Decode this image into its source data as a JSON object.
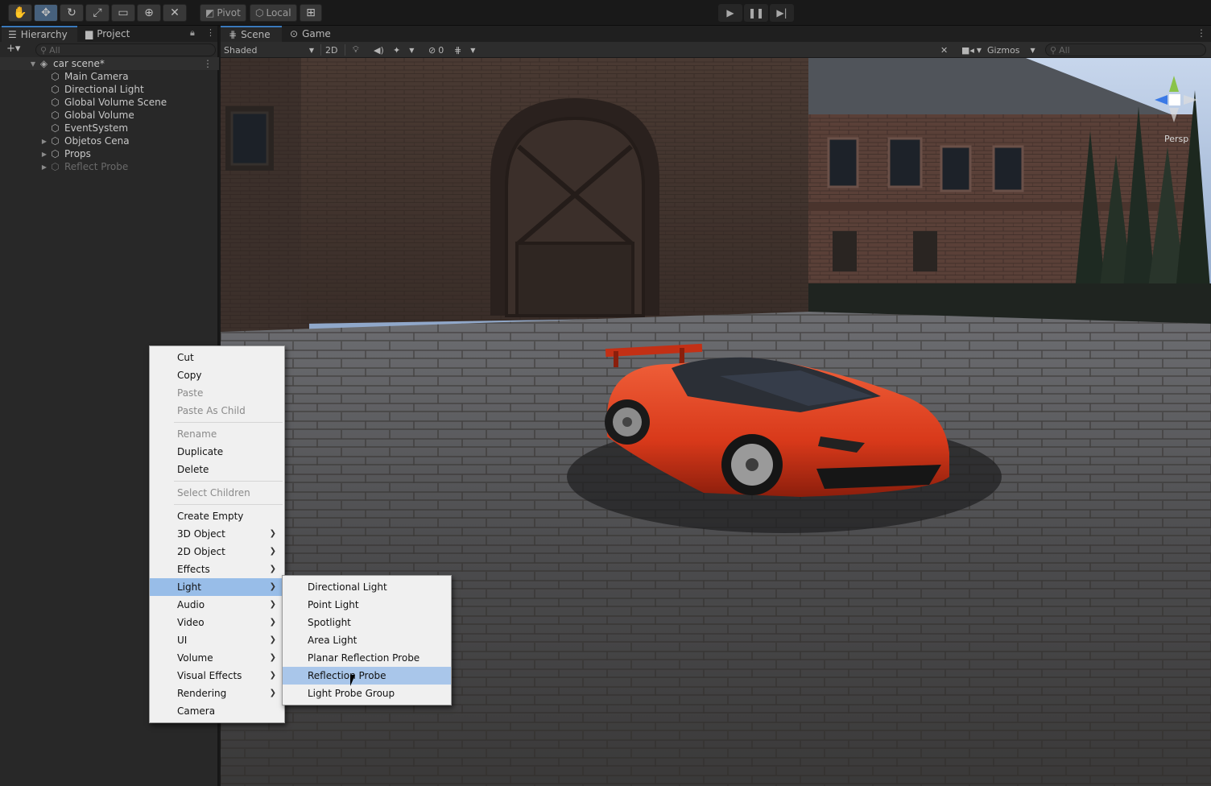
{
  "toolbar": {
    "pivot_label": "Pivot",
    "local_label": "Local",
    "tools": [
      "hand-tool",
      "move-tool",
      "rotate-tool",
      "scale-tool",
      "rect-tool",
      "transform-tool",
      "custom-tool"
    ]
  },
  "hierarchy": {
    "tab_label": "Hierarchy",
    "project_tab_label": "Project",
    "search_placeholder": "All",
    "scene_name": "car scene*",
    "items": [
      {
        "label": "Main Camera",
        "expandable": false,
        "disabled": false
      },
      {
        "label": "Directional Light",
        "expandable": false,
        "disabled": false
      },
      {
        "label": "Global Volume Scene",
        "expandable": false,
        "disabled": false
      },
      {
        "label": "Global Volume",
        "expandable": false,
        "disabled": false
      },
      {
        "label": "EventSystem",
        "expandable": false,
        "disabled": false
      },
      {
        "label": "Objetos Cena",
        "expandable": true,
        "disabled": false
      },
      {
        "label": "Props",
        "expandable": true,
        "disabled": false
      },
      {
        "label": "Reflect Probe",
        "expandable": true,
        "disabled": true
      }
    ]
  },
  "scene_view": {
    "scene_tab": "Scene",
    "game_tab": "Game",
    "shading_mode": "Shaded",
    "mode_2d": "2D",
    "hidden_count": "0",
    "gizmos_label": "Gizmos",
    "search_placeholder": "All",
    "persp_label": "Persp"
  },
  "context_menu": {
    "items": [
      {
        "label": "Cut",
        "disabled": false,
        "submenu": false
      },
      {
        "label": "Copy",
        "disabled": false,
        "submenu": false
      },
      {
        "label": "Paste",
        "disabled": true,
        "submenu": false
      },
      {
        "label": "Paste As Child",
        "disabled": true,
        "submenu": false
      },
      {
        "separator": true
      },
      {
        "label": "Rename",
        "disabled": true,
        "submenu": false
      },
      {
        "label": "Duplicate",
        "disabled": false,
        "submenu": false
      },
      {
        "label": "Delete",
        "disabled": false,
        "submenu": false
      },
      {
        "separator": true
      },
      {
        "label": "Select Children",
        "disabled": true,
        "submenu": false
      },
      {
        "separator": true
      },
      {
        "label": "Create Empty",
        "disabled": false,
        "submenu": false
      },
      {
        "label": "3D Object",
        "disabled": false,
        "submenu": true
      },
      {
        "label": "2D Object",
        "disabled": false,
        "submenu": true
      },
      {
        "label": "Effects",
        "disabled": false,
        "submenu": true
      },
      {
        "label": "Light",
        "disabled": false,
        "submenu": true,
        "highlighted": true
      },
      {
        "label": "Audio",
        "disabled": false,
        "submenu": true
      },
      {
        "label": "Video",
        "disabled": false,
        "submenu": true
      },
      {
        "label": "UI",
        "disabled": false,
        "submenu": true
      },
      {
        "label": "Volume",
        "disabled": false,
        "submenu": true
      },
      {
        "label": "Visual Effects",
        "disabled": false,
        "submenu": true
      },
      {
        "label": "Rendering",
        "disabled": false,
        "submenu": true
      },
      {
        "label": "Camera",
        "disabled": false,
        "submenu": false
      }
    ]
  },
  "light_submenu": {
    "items": [
      {
        "label": "Directional Light",
        "highlighted": false
      },
      {
        "label": "Point Light",
        "highlighted": false
      },
      {
        "label": "Spotlight",
        "highlighted": false
      },
      {
        "label": "Area Light",
        "highlighted": false
      },
      {
        "label": "Planar Reflection Probe",
        "highlighted": false
      },
      {
        "label": "Reflection Probe",
        "highlighted": true
      },
      {
        "label": "Light Probe Group",
        "highlighted": false
      }
    ]
  },
  "colors": {
    "accent": "#3a79bb",
    "menu_highlight": "#a9c6ea",
    "car": "#d8391a"
  }
}
